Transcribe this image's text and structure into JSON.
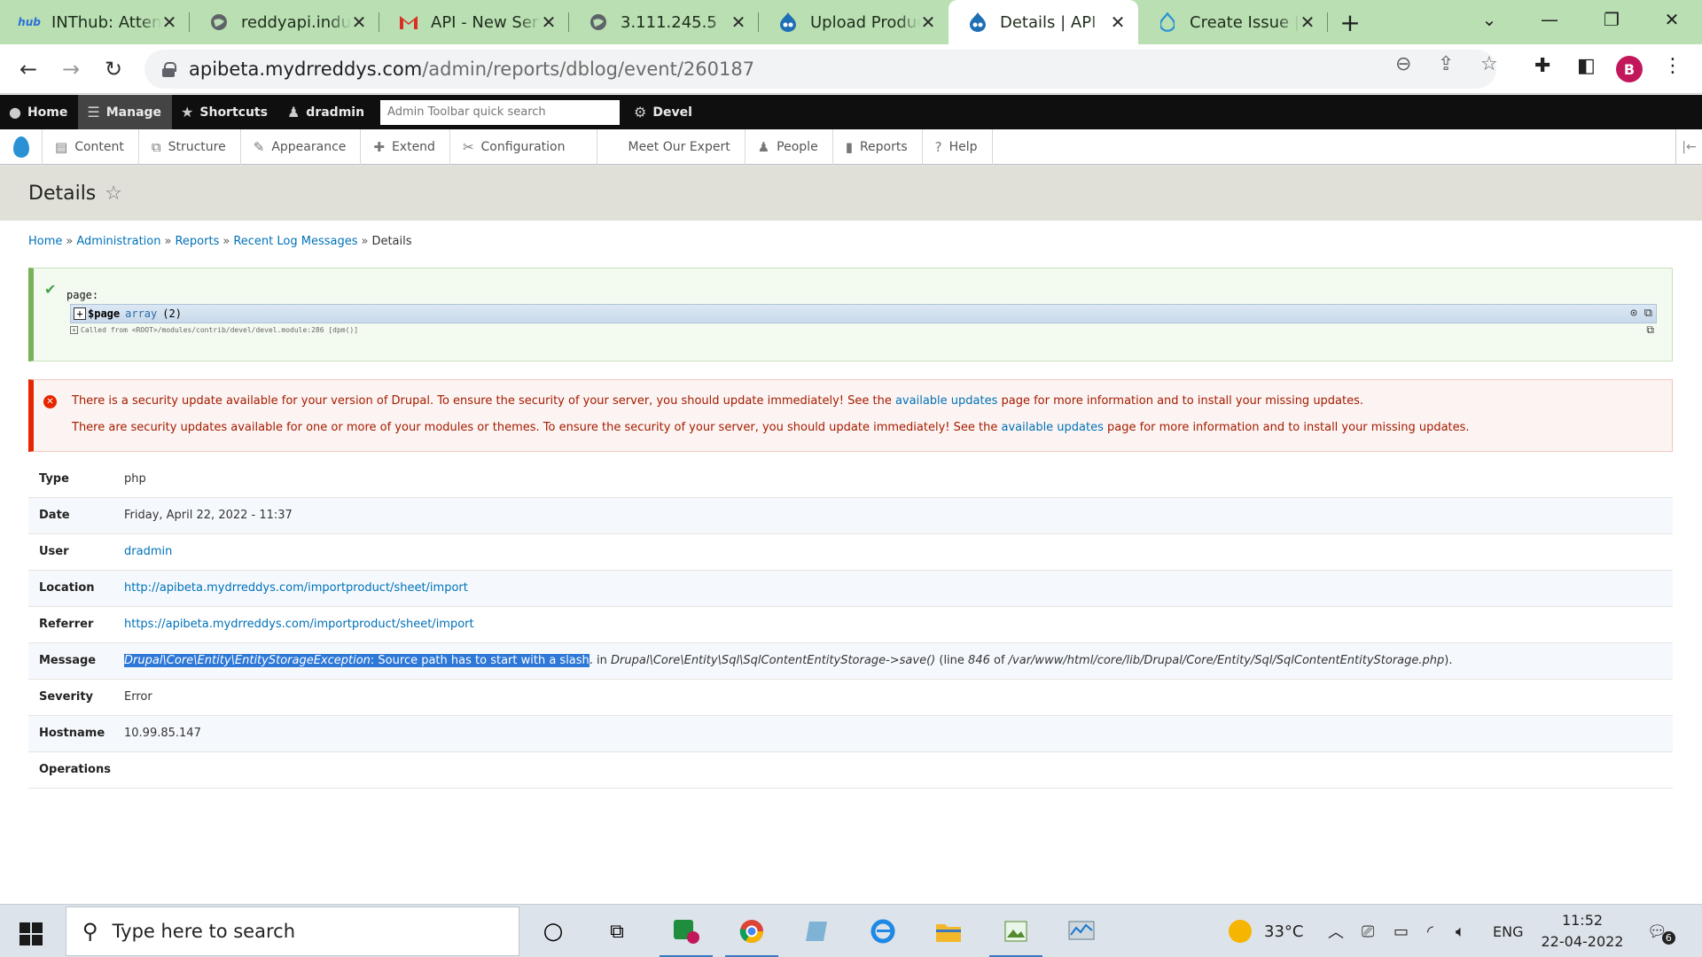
{
  "browser": {
    "tabs": [
      {
        "title": "INThub: Attendance",
        "favicon": "hub-logo-icon",
        "favicon_text": "hub",
        "active": false
      },
      {
        "title": "reddyapi.industries",
        "favicon": "globe-icon",
        "active": false
      },
      {
        "title": "API - New Server",
        "favicon": "gmail-icon",
        "active": false
      },
      {
        "title": "3.111.245.5",
        "favicon": "globe-icon",
        "active": false
      },
      {
        "title": "Upload Products",
        "favicon": "drupal-icon",
        "active": false
      },
      {
        "title": "Details | API",
        "favicon": "drupal-icon",
        "active": true
      },
      {
        "title": "Create Issue | Drupal",
        "favicon": "drupal-icon",
        "active": false
      }
    ],
    "url_host": "apibeta.mydrreddys.com",
    "url_path": "/admin/reports/dblog/event/260187",
    "profile_initial": "B"
  },
  "toolbar": {
    "primary": [
      {
        "label": "Home",
        "icon": "drupal-home-icon"
      },
      {
        "label": "Manage",
        "icon": "hamburger-icon"
      },
      {
        "label": "Shortcuts",
        "icon": "star-icon"
      },
      {
        "label": "dradmin",
        "icon": "user-icon"
      }
    ],
    "search_placeholder": "Admin Toolbar quick search",
    "devel_label": "Devel",
    "secondary": [
      {
        "label": "Content",
        "icon": "document-icon"
      },
      {
        "label": "Structure",
        "icon": "sitemap-icon"
      },
      {
        "label": "Appearance",
        "icon": "brush-icon"
      },
      {
        "label": "Extend",
        "icon": "puzzle-icon"
      },
      {
        "label": "Configuration",
        "icon": "wrench-icon"
      },
      {
        "label": "Meet Our Expert",
        "icon": ""
      },
      {
        "label": "People",
        "icon": "people-icon"
      },
      {
        "label": "Reports",
        "icon": "bar-chart-icon"
      },
      {
        "label": "Help",
        "icon": "help-icon"
      }
    ]
  },
  "page": {
    "title": "Details",
    "breadcrumb": [
      "Home",
      "Administration",
      "Reports",
      "Recent Log Messages",
      "Details"
    ],
    "breadcrumb_sep": "»"
  },
  "devel": {
    "label": "page:",
    "var_name": "$page",
    "var_type": "array",
    "var_count": "(2)",
    "called_from": "Called from <ROOT>/modules/contrib/devel/devel.module:286 [dpm()]"
  },
  "error": {
    "line1_pre": "There is a security update available for your version of Drupal. To ensure the security of your server, you should update immediately! See the",
    "line1_link": "available updates",
    "line1_post": "page for more information and to install your missing updates.",
    "line2_pre": "There are security updates available for one or more of your modules or themes. To ensure the security of your server, you should update immediately! See the",
    "line2_link": "available updates",
    "line2_post": "page for more information and to install your missing updates."
  },
  "details": {
    "type_label": "Type",
    "type_value": "php",
    "date_label": "Date",
    "date_value": "Friday, April 22, 2022 - 11:37",
    "user_label": "User",
    "user_value": "dradmin",
    "location_label": "Location",
    "location_value": "http://apibeta.mydrreddys.com/importproduct/sheet/import",
    "referrer_label": "Referrer",
    "referrer_value": "https://apibeta.mydrreddys.com/importproduct/sheet/import",
    "message_label": "Message",
    "message_exception": "Drupal\\Core\\Entity\\EntityStorageException",
    "message_text": ": Source path has to start with a slash",
    "message_in": ". in ",
    "message_func": "Drupal\\Core\\Entity\\Sql\\SqlContentEntityStorage->save()",
    "message_line_pre": " (line ",
    "message_line": "846",
    "message_of": " of ",
    "message_file": "/var/www/html/core/lib/Drupal/Core/Entity/Sql/SqlContentEntityStorage.php",
    "message_end": ").",
    "severity_label": "Severity",
    "severity_value": "Error",
    "hostname_label": "Hostname",
    "hostname_value": "10.99.85.147",
    "operations_label": "Operations"
  },
  "taskbar": {
    "search_placeholder": "Type here to search",
    "weather": "33°C",
    "language": "ENG",
    "time": "11:52",
    "date": "22-04-2022",
    "notification_count": "6"
  }
}
